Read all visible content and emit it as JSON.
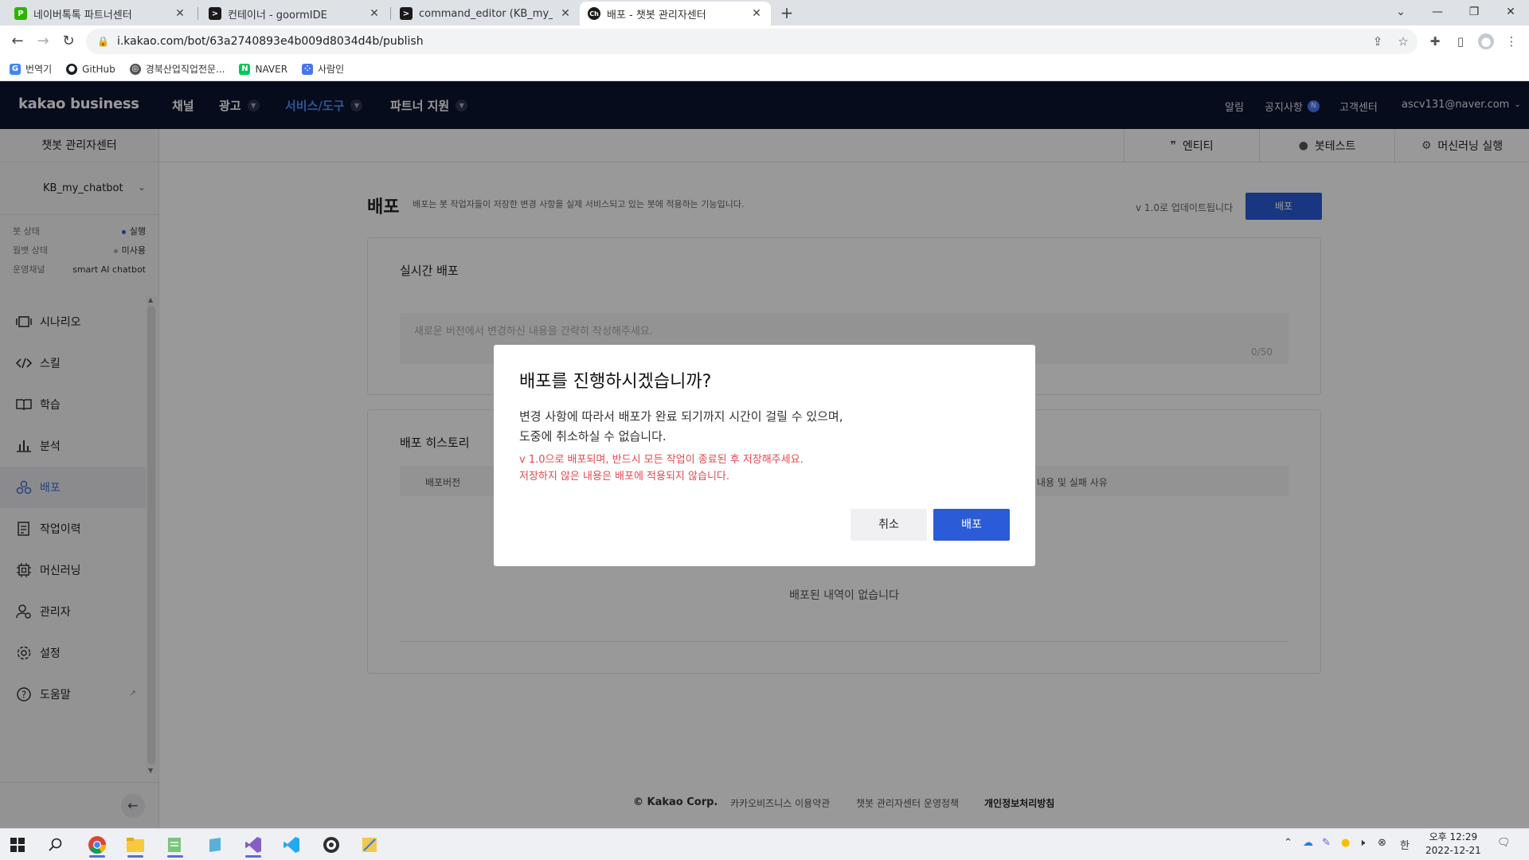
{
  "browser": {
    "tabs": [
      {
        "title": "네이버톡톡 파트너센터",
        "fav_color": "#2db400",
        "fav_glyph": "P",
        "active": false
      },
      {
        "title": "컨테이너 - goormIDE",
        "fav_color": "#1a1a1a",
        "fav_glyph": ">",
        "active": false
      },
      {
        "title": "command_editor (KB_my_chatbo",
        "fav_color": "#1a1a1a",
        "fav_glyph": ">",
        "active": false
      },
      {
        "title": "배포 - 챗봇 관리자센터",
        "fav_color": "#1a1a1a",
        "fav_glyph": "Ch",
        "active": true
      }
    ],
    "url": "i.kakao.com/bot/63a2740893e4b009d8034d4b/publish",
    "bookmarks": [
      {
        "label": "번역기",
        "color": "#4285f4",
        "glyph": "G"
      },
      {
        "label": "GitHub",
        "color": "#1b1f23",
        "glyph": "●"
      },
      {
        "label": "경북산업직업전문...",
        "color": "#555555",
        "glyph": "◎"
      },
      {
        "label": "NAVER",
        "color": "#03c75a",
        "glyph": "N"
      },
      {
        "label": "사람인",
        "color": "#4876ef",
        "glyph": "⁘"
      }
    ]
  },
  "header": {
    "logo": "kakao business",
    "nav": [
      {
        "label": "채널",
        "caret": false,
        "active": false
      },
      {
        "label": "광고",
        "caret": true,
        "active": false
      },
      {
        "label": "서비스/도구",
        "caret": true,
        "active": true
      },
      {
        "label": "파트너 지원",
        "caret": true,
        "active": false
      }
    ],
    "right": {
      "alerts": "알림",
      "notice": "공지사항",
      "notice_badge": "N",
      "support": "고객센터",
      "account": "ascv131@naver.com"
    }
  },
  "sidebar": {
    "title": "챗봇 관리자센터",
    "bot_name": "KB_my_chatbot",
    "status": [
      {
        "label": "봇 상태",
        "value": "실행",
        "dot_color": "#2b5bd7"
      },
      {
        "label": "웜뱃 상태",
        "value": "미사용",
        "dot_color": "#aaaaaa"
      },
      {
        "label": "운영채널",
        "value": "smart AI chatbot",
        "dot_color": ""
      }
    ],
    "items": [
      {
        "label": "시나리오",
        "icon": "scenario-icon",
        "active": false
      },
      {
        "label": "스킬",
        "icon": "code-icon",
        "active": false
      },
      {
        "label": "학습",
        "icon": "book-icon",
        "active": false
      },
      {
        "label": "분석",
        "icon": "chart-icon",
        "active": false
      },
      {
        "label": "배포",
        "icon": "deploy-icon",
        "active": true
      },
      {
        "label": "작업이력",
        "icon": "history-icon",
        "active": false
      },
      {
        "label": "머신러닝",
        "icon": "chip-icon",
        "active": false
      },
      {
        "label": "관리자",
        "icon": "admin-icon",
        "active": false
      },
      {
        "label": "설정",
        "icon": "gear-icon",
        "active": false
      },
      {
        "label": "도움말",
        "icon": "help-icon",
        "active": false,
        "external": true
      }
    ]
  },
  "tools": {
    "entity": "엔티티",
    "bottest": "봇테스트",
    "ml_run": "머신러닝 실행"
  },
  "page": {
    "title": "배포",
    "description": "배포는 봇 작업자들이 저장한 변경 사항을 실제 서비스되고 있는 봇에 적용하는 기능입니다.",
    "version_note": "v 1.0로 업데이트됩니다",
    "deploy_button": "배포",
    "realtime": {
      "title": "실시간 배포",
      "placeholder": "새로운 버전에서 변경하신 내용을 간략히 작성해주세요.",
      "counter": "0/50"
    },
    "history": {
      "title": "배포 히스토리",
      "col_version": "배포버전",
      "col_reason": "내용 및 실패 사유",
      "empty": "배포된 내역이 없습니다"
    },
    "footer": {
      "copyright": "© Kakao Corp.",
      "terms": "카카오비즈니스 이용약관",
      "policy": "챗봇 관리자센터 운영정책",
      "privacy": "개인정보처리방침"
    }
  },
  "modal": {
    "title": "배포를 진행하시겠습니까?",
    "body_line1": "변경 사항에 따라서 배포가 완료 되기까지 시간이 걸릴 수 있으며,",
    "body_line2": "도중에 취소하실 수 없습니다.",
    "warn_line1": "v 1.0으로 배포되며, 반드시 모든 작업이 종료된 후 저장해주세요.",
    "warn_line2": "저장하지 않은 내용은 배포에 적용되지 않습니다.",
    "cancel": "취소",
    "confirm": "배포"
  },
  "taskbar": {
    "ime": "한",
    "time": "오후 12:29",
    "date": "2022-12-21"
  }
}
